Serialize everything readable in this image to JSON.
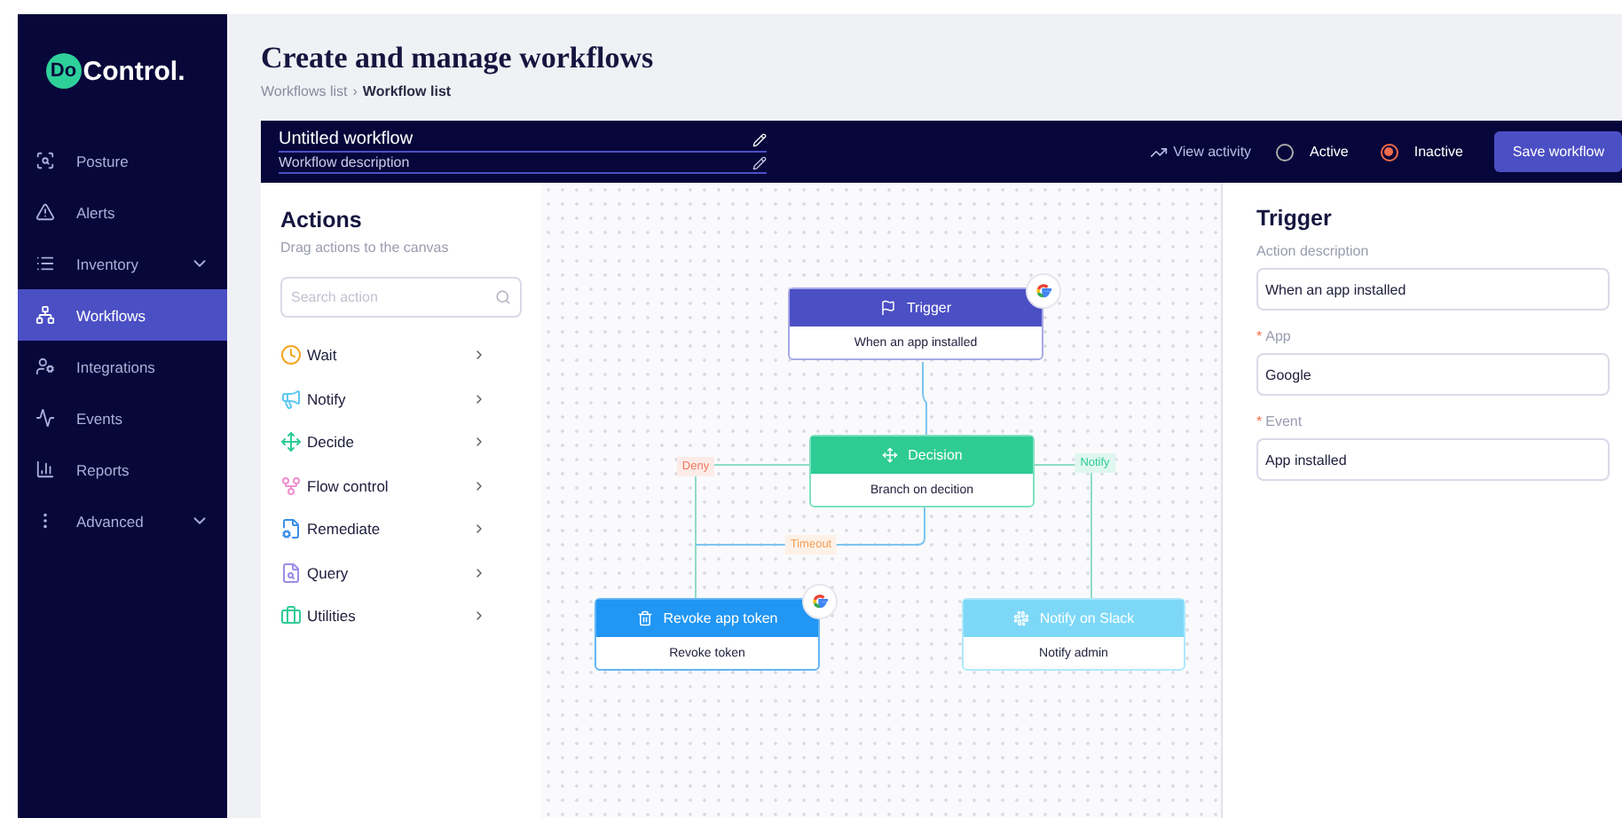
{
  "sidebar": {
    "logo": {
      "mark": "Do",
      "name": "Control."
    },
    "items": [
      {
        "label": "Posture",
        "selected": false,
        "collapsible": false
      },
      {
        "label": "Alerts",
        "selected": false,
        "collapsible": false
      },
      {
        "label": "Inventory",
        "selected": false,
        "collapsible": true
      },
      {
        "label": "Workflows",
        "selected": true,
        "collapsible": false
      },
      {
        "label": "Integrations",
        "selected": false,
        "collapsible": false
      },
      {
        "label": "Events",
        "selected": false,
        "collapsible": false
      },
      {
        "label": "Reports",
        "selected": false,
        "collapsible": false
      },
      {
        "label": "Advanced",
        "selected": false,
        "collapsible": true
      }
    ]
  },
  "page": {
    "title": "Create and manage workflows",
    "breadcrumb": [
      "Workflows list",
      "Workflow list"
    ],
    "breadcrumb_separator": "›"
  },
  "toolbar": {
    "name": "Untitled workflow",
    "description": "Workflow description",
    "view_activity": "View activity",
    "status": [
      {
        "label": "Active",
        "selected": false
      },
      {
        "label": "Inactive",
        "selected": true
      }
    ],
    "save": "Save workflow"
  },
  "actions": {
    "title": "Actions",
    "subtitle": "Drag actions to the canvas",
    "search": {
      "placeholder": "Search action"
    },
    "items": [
      "Wait",
      "Notify",
      "Decide",
      "Flow control",
      "Remediate",
      "Query",
      "Utilities"
    ]
  },
  "canvas": {
    "nodes": [
      {
        "kind": "trigger",
        "title": "Trigger",
        "subtitle": "When an app installed",
        "app_badge": true
      },
      {
        "kind": "decision",
        "title": "Decision",
        "subtitle": "Branch on decition",
        "app_badge": false
      },
      {
        "kind": "revoke",
        "title": "Revoke app token",
        "subtitle": "Revoke token",
        "app_badge": true
      },
      {
        "kind": "notify",
        "title": "Notify on Slack",
        "subtitle": "Notify admin",
        "app_badge": false
      }
    ],
    "edge_labels": [
      {
        "label": "Deny",
        "color": "#f07860"
      },
      {
        "label": "Notify",
        "color": "#2ecc94"
      },
      {
        "label": "Timeout",
        "color": "#f5a05a"
      }
    ]
  },
  "details": {
    "title": "Trigger",
    "required_mark": "*",
    "fields": [
      {
        "label": "Action description",
        "value": "When an app installed",
        "required": false
      },
      {
        "label": "App",
        "value": "Google",
        "required": true
      },
      {
        "label": "Event",
        "value": "App installed",
        "required": true
      }
    ]
  }
}
